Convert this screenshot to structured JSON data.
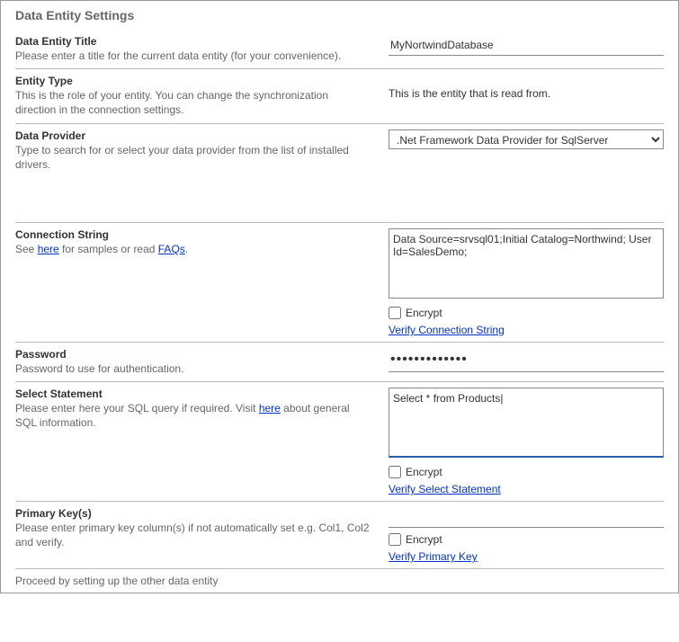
{
  "page": {
    "title": "Data Entity Settings"
  },
  "dataEntityTitle": {
    "label": "Data Entity Title",
    "desc": "Please enter a title for the current data entity (for your convenience).",
    "value": "MyNortwindDatabase"
  },
  "entityType": {
    "label": "Entity Type",
    "desc": "This is the role of your entity. You can change the synchronization direction in the connection settings.",
    "value": "This is the entity that is read from."
  },
  "dataProvider": {
    "label": "Data Provider",
    "desc": "Type to search for or select your data provider from the list of installed drivers.",
    "selected": ".Net Framework Data Provider for SqlServer"
  },
  "connectionString": {
    "label": "Connection String",
    "descPrefix": "See ",
    "descLink1": "here",
    "descMid": " for samples or read ",
    "descLink2": "FAQs",
    "descSuffix": ".",
    "value": "Data Source=srvsql01;Initial Catalog=Northwind; User Id=SalesDemo;",
    "encryptLabel": "Encrypt",
    "verifyLink": "Verify Connection String"
  },
  "password": {
    "label": "Password",
    "desc": "Password to use for authentication.",
    "value": "•••••••••••••"
  },
  "selectStatement": {
    "label": "Select Statement",
    "descPrefix": "Please enter here your SQL query if required. Visit ",
    "descLink": "here",
    "descSuffix": " about general SQL information.",
    "value": "Select * from Products|",
    "encryptLabel": "Encrypt",
    "verifyLink": "Verify Select Statement"
  },
  "primaryKey": {
    "label": "Primary Key(s)",
    "desc": "Please enter primary key column(s) if not automatically set e.g. Col1, Col2 and verify.",
    "value": "",
    "encryptLabel": "Encrypt",
    "verifyLink": "Verify Primary Key"
  },
  "footer": {
    "text": "Proceed by setting up the other data entity"
  }
}
